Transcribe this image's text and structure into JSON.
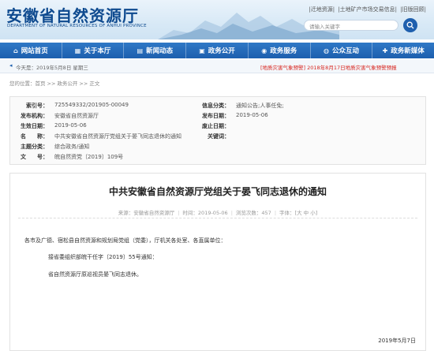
{
  "header": {
    "logo_cn": "安徽省自然资源厅",
    "logo_en": "DEPARTMENT OF NATURAL RESOURCES OF ANHUI PROVINCE",
    "top_links": [
      "|迁地资源|",
      "|土地矿产市场交易信息|",
      "|旧版回顾|"
    ],
    "search_placeholder": "请输入关键字"
  },
  "nav": {
    "items": [
      {
        "label": "网站首页",
        "icon": "home-icon"
      },
      {
        "label": "关于本厅",
        "icon": "building-icon"
      },
      {
        "label": "新闻动态",
        "icon": "news-icon"
      },
      {
        "label": "政务公开",
        "icon": "folder-icon"
      },
      {
        "label": "政务服务",
        "icon": "service-icon"
      },
      {
        "label": "公众互动",
        "icon": "chat-icon"
      },
      {
        "label": "政务新媒体",
        "icon": "media-icon"
      }
    ]
  },
  "ticker": {
    "date": "今天是：2019年5月8日 星期三",
    "alert": "[地质灾害气象预警] 2018年8月17日地质灾害气象预警预报"
  },
  "breadcrumb": {
    "prefix": "您的位置：",
    "items": [
      "首页",
      "政务公开",
      "正文"
    ],
    "sep": ">>"
  },
  "info": {
    "index_no_label": "索引号：",
    "index_no": "725549332/201905-00049",
    "category_label": "信息分类：",
    "category": "通知公告;人事任免;",
    "issuer_label": "发布机构：",
    "issuer": "安徽省自然资源厅",
    "pub_date_label": "发布日期：",
    "pub_date": "2019-05-06",
    "effective_label": "生效日期：",
    "effective": "2019-05-06",
    "repeal_label": "废止日期：",
    "repeal": "",
    "name_label": "名　　称：",
    "name": "中共安徽省自然资源厅党组关于晏飞同志退休的通知",
    "keywords_label": "关键词：",
    "keywords": "",
    "topic_label": "主题分类：",
    "topic": "综合政务/通知",
    "doc_no_label": "文　　号：",
    "doc_no": "皖自然资党〔2019〕109号"
  },
  "article": {
    "title": "中共安徽省自然资源厅党组关于晏飞同志退休的通知",
    "source": "来源：安徽省自然资源厅",
    "date": "时间：2019-05-06",
    "views": "浏览次数：457",
    "font_prefix": "字体：[",
    "font_options": [
      "大",
      "中",
      "小"
    ],
    "font_suffix": "]",
    "p1": "各市及广德、宿松县自然资源和规划局党组（党委），厅机关各处室、各直属单位：",
    "p2": "接省委组织部皖干任字〔2019〕55号通知：",
    "p3": "省自然资源厅原巡视员晏飞同志退休。",
    "sign_date": "2019年5月7日"
  },
  "colors": {
    "brand": "#1d5fae",
    "alert": "#d8261f"
  }
}
